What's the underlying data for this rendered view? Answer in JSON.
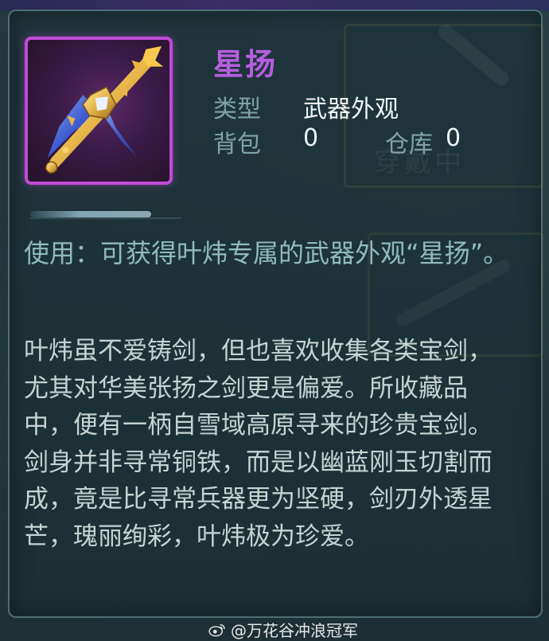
{
  "item": {
    "name": "星扬",
    "name_color": "#b65ee0",
    "icon": "sword-weapon-icon",
    "rarity_color": "#c24ad8"
  },
  "attributes": {
    "type_label": "类型",
    "type_value": "武器外观",
    "bag_label": "背包",
    "bag_value": "0",
    "warehouse_label": "仓库",
    "warehouse_value": "0"
  },
  "usage": "使用：可获得叶炜专属的武器外观“星扬”。",
  "lore": "叶炜虽不爱铸剑，但也喜欢收集各类宝剑，尤其对华美张扬之剑更是偏爱。所收藏品中，便有一柄自雪域高原寻来的珍贵宝剑。剑身并非寻常铜铁，而是以幽蓝刚玉切割而成，竟是比寻常兵器更为坚硬，剑刃外透星芒，瑰丽绚彩，叶炜极为珍爱。",
  "background_text": "穿戴中",
  "watermark": "@万花谷冲浪冠军",
  "watermark_icon": "weibo-logo-icon"
}
